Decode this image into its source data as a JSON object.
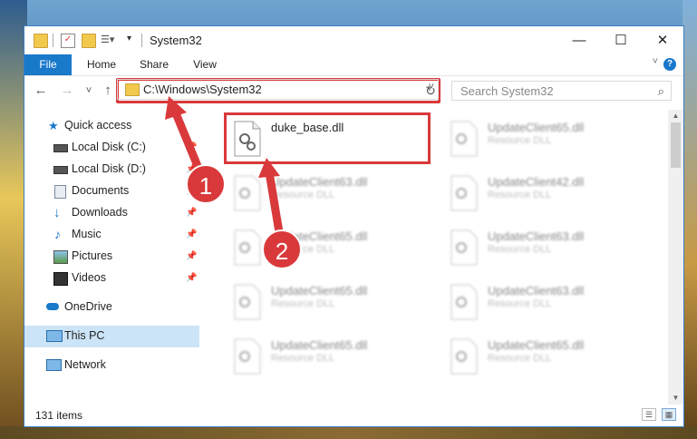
{
  "window": {
    "title": "System32",
    "controls": {
      "minimize": "—",
      "maximize": "☐",
      "close": "✕"
    }
  },
  "ribbon": {
    "tabs": [
      {
        "label": "File"
      },
      {
        "label": "Home"
      },
      {
        "label": "Share"
      },
      {
        "label": "View"
      }
    ],
    "help": "?"
  },
  "navigation": {
    "back": "←",
    "forward": "→",
    "recent": "˅",
    "up": "↑",
    "address": "C:\\Windows\\System32",
    "search_placeholder": "Search System32"
  },
  "sidebar": {
    "items": [
      {
        "label": "Quick access",
        "icon": "star-icon"
      },
      {
        "label": "Local Disk (C:)",
        "icon": "drive-icon"
      },
      {
        "label": "Local Disk (D:)",
        "icon": "drive-icon"
      },
      {
        "label": "Documents",
        "icon": "documents-icon"
      },
      {
        "label": "Downloads",
        "icon": "download-icon"
      },
      {
        "label": "Music",
        "icon": "music-icon"
      },
      {
        "label": "Pictures",
        "icon": "pictures-icon"
      },
      {
        "label": "Videos",
        "icon": "videos-icon"
      },
      {
        "label": "OneDrive",
        "icon": "cloud-icon"
      },
      {
        "label": "This PC",
        "icon": "computer-icon"
      },
      {
        "label": "Network",
        "icon": "network-icon"
      }
    ]
  },
  "files": [
    {
      "name": "duke_base.dll",
      "type": ""
    },
    {
      "name": "UpdateClient65.dll",
      "type": "Resource DLL"
    },
    {
      "name": "UpdateClient63.dll",
      "type": "Resource DLL"
    },
    {
      "name": "UpdateClient42.dll",
      "type": "Resource DLL"
    },
    {
      "name": "UpdateClient65.dll",
      "type": "Resource DLL"
    },
    {
      "name": "UpdateClient63.dll",
      "type": "Resource DLL"
    },
    {
      "name": "UpdateClient65.dll",
      "type": "Resource DLL"
    },
    {
      "name": "UpdateClient63.dll",
      "type": "Resource DLL"
    },
    {
      "name": "UpdateClient65.dll",
      "type": "Resource DLL"
    },
    {
      "name": "UpdateClient65.dll",
      "type": "Resource DLL"
    }
  ],
  "status": {
    "item_count": "131 items"
  },
  "annotations": {
    "callout1": "1",
    "callout2": "2",
    "highlight_color": "#d9393b"
  }
}
